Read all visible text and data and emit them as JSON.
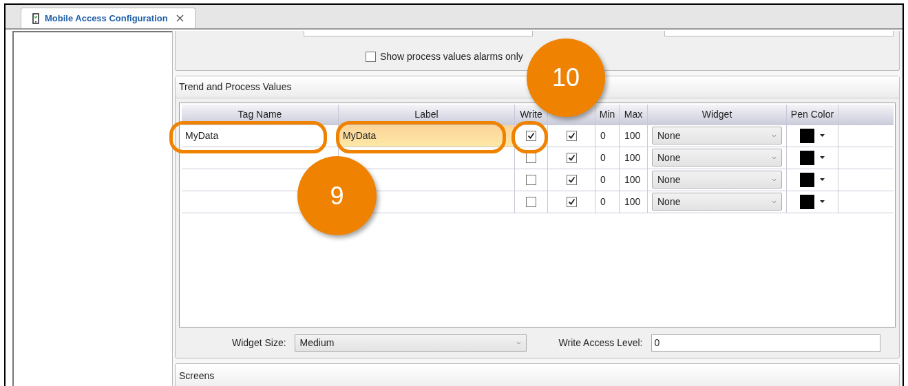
{
  "tab": {
    "title": "Mobile Access Configuration",
    "selected": true
  },
  "alarms_option": {
    "label": "Show process values alarms only",
    "checked": false
  },
  "trend_section": {
    "title": "Trend and Process Values",
    "columns": [
      "Tag Name",
      "Label",
      "Write",
      "",
      "Min",
      "Max",
      "Widget",
      "Pen Color"
    ],
    "rows": [
      {
        "tag_name": "MyData",
        "label": "MyData",
        "label_editing": true,
        "write": true,
        "trending": true,
        "min": "0",
        "max": "100",
        "widget": "None",
        "color": "#000000"
      },
      {
        "tag_name": "",
        "label": "",
        "label_editing": false,
        "write": false,
        "trending": true,
        "min": "0",
        "max": "100",
        "widget": "None",
        "color": "#000000"
      },
      {
        "tag_name": "",
        "label": "",
        "label_editing": false,
        "write": false,
        "trending": true,
        "min": "0",
        "max": "100",
        "widget": "None",
        "color": "#000000"
      },
      {
        "tag_name": "",
        "label": "",
        "label_editing": false,
        "write": false,
        "trending": true,
        "min": "0",
        "max": "100",
        "widget": "None",
        "color": "#000000"
      }
    ],
    "widget_size": {
      "label": "Widget Size:",
      "value": "Medium"
    },
    "write_access": {
      "label": "Write Access Level:",
      "value": "0"
    }
  },
  "screens_section": {
    "title": "Screens"
  },
  "callouts": [
    {
      "number": "9"
    },
    {
      "number": "10"
    }
  ]
}
